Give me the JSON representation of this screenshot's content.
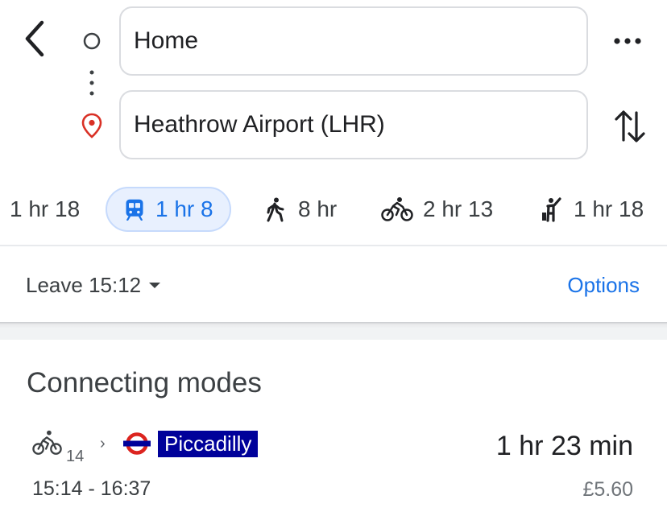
{
  "header": {
    "origin": "Home",
    "destination": "Heathrow Airport (LHR)"
  },
  "modes": [
    {
      "label": "1 hr 18",
      "icon": "drive-icon"
    },
    {
      "label": "1 hr 8",
      "icon": "transit-icon",
      "selected": true
    },
    {
      "label": "8 hr",
      "icon": "walk-icon"
    },
    {
      "label": "2 hr 13",
      "icon": "bike-icon"
    },
    {
      "label": "1 hr 18",
      "icon": "ride-hail-icon"
    }
  ],
  "filters": {
    "leave_label": "Leave 15:12",
    "options_label": "Options"
  },
  "section": {
    "title": "Connecting modes"
  },
  "route": {
    "bike_minutes": "14",
    "line_name": "Piccadilly",
    "duration": "1 hr 23 min",
    "times": "15:14 - 16:37",
    "price": "£5.60"
  },
  "colors": {
    "accent": "#1a73e8",
    "selected_bg": "#e8f0fe",
    "pin_red": "#d93025",
    "piccadilly_line": "#00019a",
    "underground_red": "#dc241f"
  }
}
